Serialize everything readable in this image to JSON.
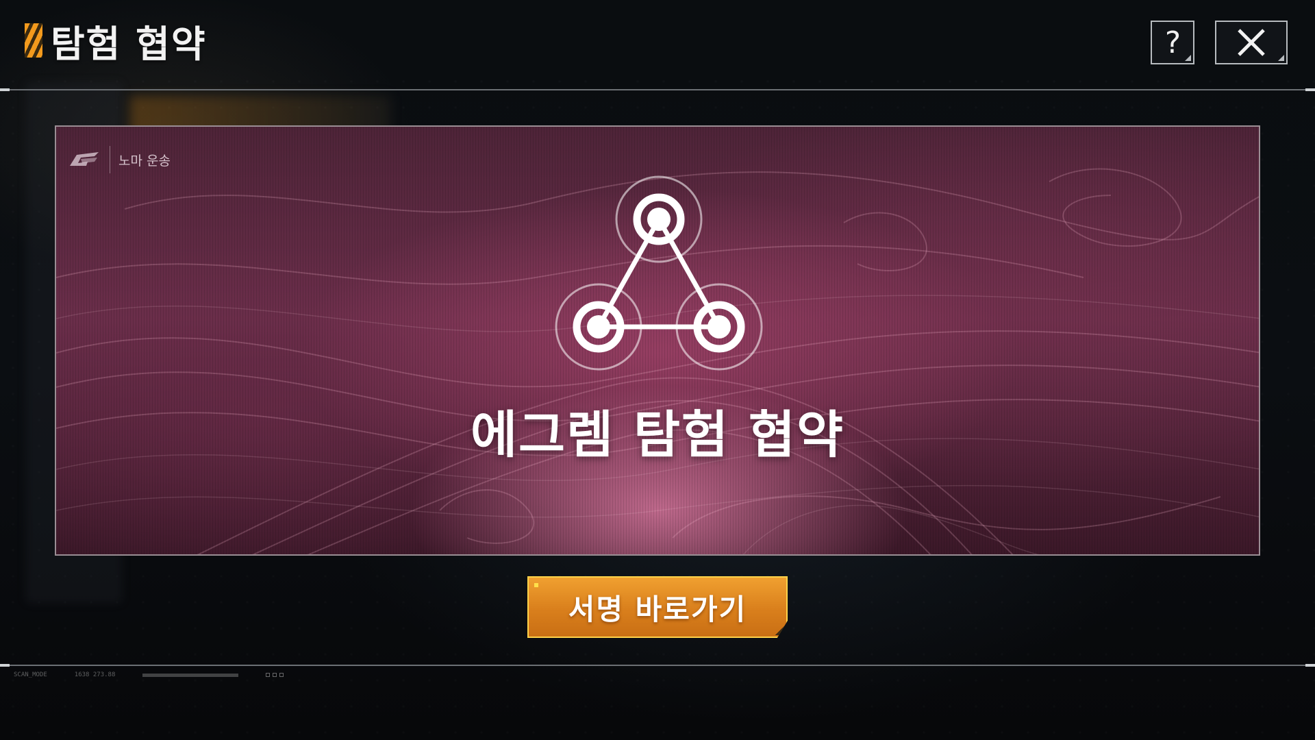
{
  "header": {
    "title": "탐험 협약",
    "help_label": "?",
    "close_icon": "close-icon"
  },
  "banner": {
    "brand_name": "노마 운송",
    "brand_icon": "noma-logo-icon",
    "emblem_icon": "triangle-nodes-icon",
    "title": "에그렘 탐험 협약"
  },
  "cta": {
    "label": "서명 바로가기"
  },
  "hud": {
    "mode": "SCAN_MODE",
    "coords": "1638 273.88"
  },
  "colors": {
    "accent": "#f39a1d",
    "cta_border": "#ffd34a",
    "banner_tint": "#6a2e4a"
  }
}
